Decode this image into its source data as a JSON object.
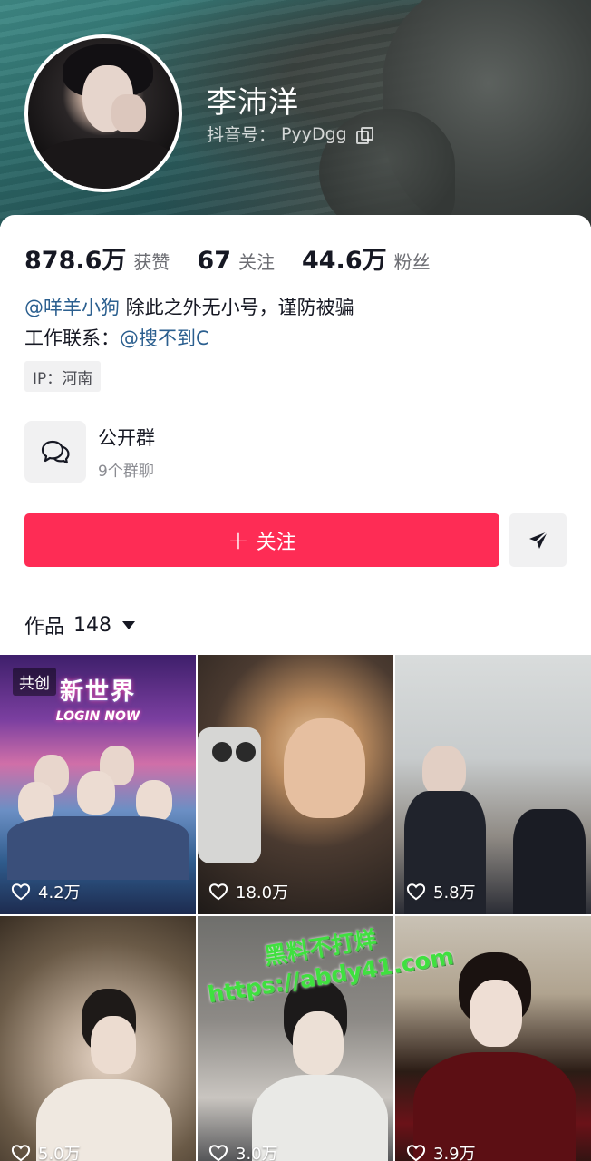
{
  "profile": {
    "name": "李沛洋",
    "handle_label": "抖音号：",
    "handle": "PyyDgg"
  },
  "stats": [
    {
      "num": "878.6万",
      "label": "获赞"
    },
    {
      "num": "67",
      "label": "关注"
    },
    {
      "num": "44.6万",
      "label": "粉丝"
    }
  ],
  "bio": {
    "mention1": "@咩羊小狗",
    "text1": " 除此之外无小号，谨防被骗",
    "contact_label": "工作联系：",
    "mention2": "@搜不到C"
  },
  "ip": "IP：河南",
  "group": {
    "title": "公开群",
    "subtitle": "9个群聊"
  },
  "actions": {
    "follow_plus": "+",
    "follow_label": "关注"
  },
  "works": {
    "label": "作品",
    "count": "148"
  },
  "tiles": [
    {
      "likes": "4.2万",
      "badge": "共创",
      "title": "新世界",
      "subtitle": "LOGIN NOW"
    },
    {
      "likes": "18.0万"
    },
    {
      "likes": "5.8万"
    },
    {
      "likes": "5.0万"
    },
    {
      "likes": "3.0万"
    },
    {
      "likes": "3.9万"
    }
  ],
  "watermark": {
    "line1": "黑料不打烊",
    "line2": "https://abdy41.com"
  },
  "colors": {
    "follow_button": "#fe2c55",
    "mention": "#2b5f8f",
    "watermark": "#3fe03f"
  }
}
